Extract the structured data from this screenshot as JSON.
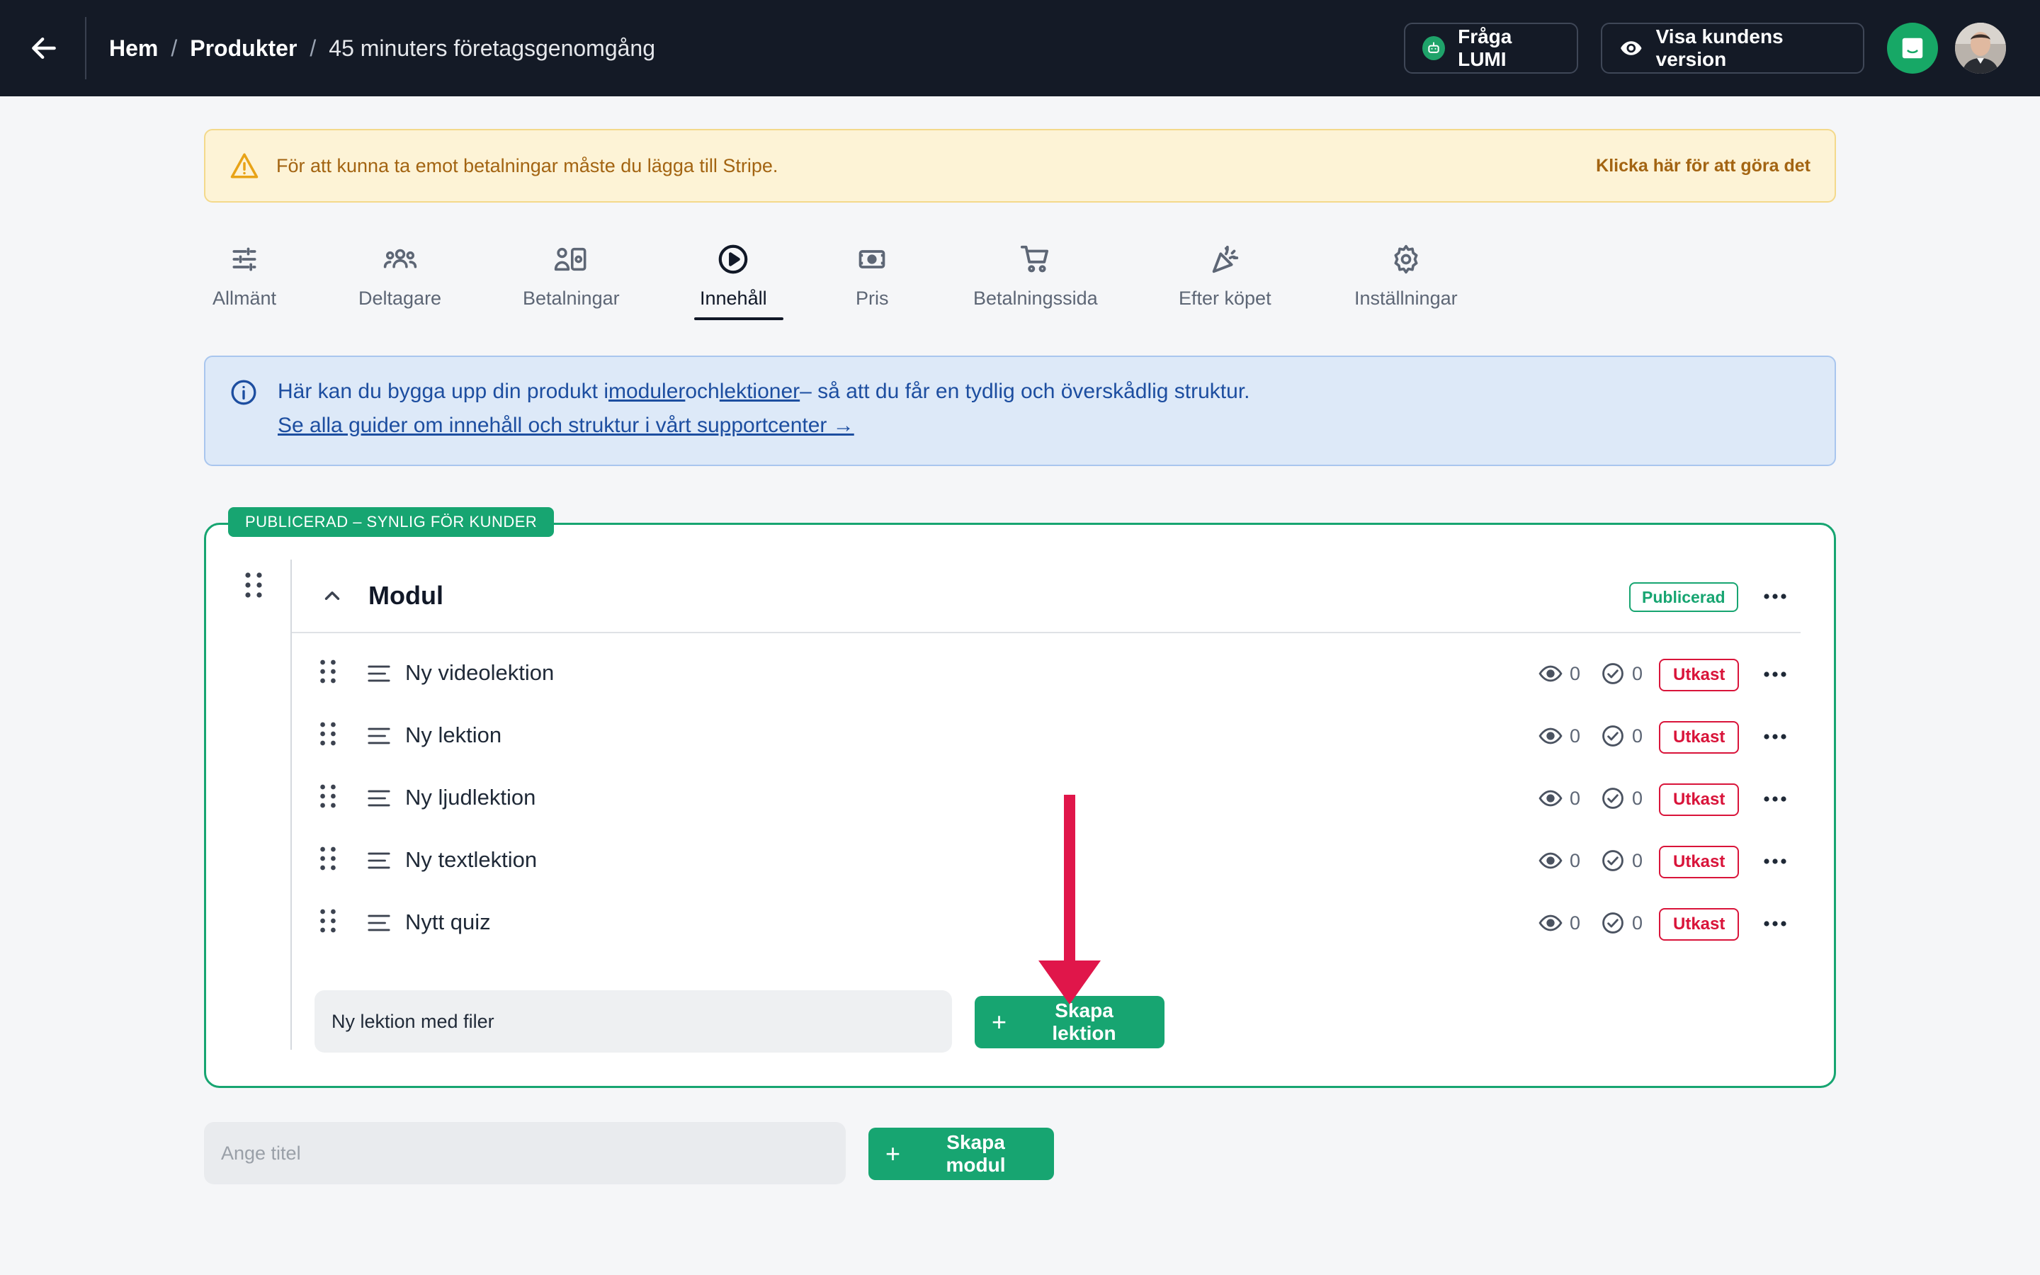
{
  "header": {
    "breadcrumb": [
      "Hem",
      "Produkter"
    ],
    "breadcrumb_current": "45 minuters företagsgenomgång",
    "separator": "/",
    "ask_lumi_label": "Fråga LUMI",
    "customer_view_label": "Visa kundens version"
  },
  "warning": {
    "text": "För att kunna ta emot betalningar måste du lägga till Stripe.",
    "link": "Klicka här för att göra det"
  },
  "tabs": [
    {
      "label": "Allmänt",
      "icon": "sliders-icon"
    },
    {
      "label": "Deltagare",
      "icon": "users-icon"
    },
    {
      "label": "Betalningar",
      "icon": "payments-icon"
    },
    {
      "label": "Innehåll",
      "icon": "play-circle-icon"
    },
    {
      "label": "Pris",
      "icon": "banknote-icon"
    },
    {
      "label": "Betalningssida",
      "icon": "cart-icon"
    },
    {
      "label": "Efter köpet",
      "icon": "party-icon"
    },
    {
      "label": "Inställningar",
      "icon": "gear-icon"
    }
  ],
  "active_tab": "Innehåll",
  "info": {
    "line1_pre": "Här kan du bygga upp din produkt i",
    "link_modules": "moduler",
    "line1_and": "och",
    "link_lessons": "lektioner",
    "line1_post": "– så att du får en tydlig och överskådlig struktur.",
    "line2_link": "Se alla guider om innehåll och struktur i vårt supportcenter →"
  },
  "module": {
    "tag": "PUBLICERAD – SYNLIG FÖR KUNDER",
    "title": "Modul",
    "status": "Publicerad",
    "lessons": [
      {
        "title": "Ny videolektion",
        "views": "0",
        "completed": "0",
        "status": "Utkast"
      },
      {
        "title": "Ny lektion",
        "views": "0",
        "completed": "0",
        "status": "Utkast"
      },
      {
        "title": "Ny ljudlektion",
        "views": "0",
        "completed": "0",
        "status": "Utkast"
      },
      {
        "title": "Ny textlektion",
        "views": "0",
        "completed": "0",
        "status": "Utkast"
      },
      {
        "title": "Nytt quiz",
        "views": "0",
        "completed": "0",
        "status": "Utkast"
      }
    ],
    "new_lesson_value": "Ny lektion med filer",
    "create_lesson_label": "Skapa lektion"
  },
  "new_module": {
    "placeholder": "Ange titel",
    "create_module_label": "Skapa modul"
  },
  "colors": {
    "topbar": "#141a26",
    "accent_green": "#17a571",
    "draft_red": "#d9143a",
    "arrow_red": "#e0164a"
  }
}
